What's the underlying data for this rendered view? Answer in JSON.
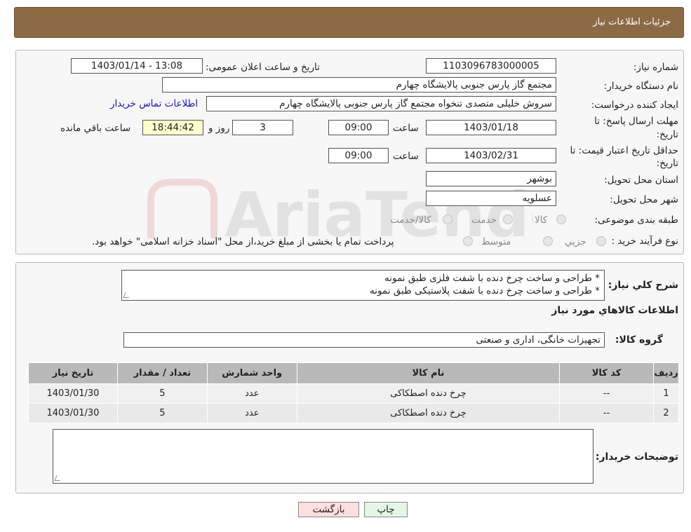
{
  "header": {
    "title": "جزئیات اطلاعات نیاز"
  },
  "fields": {
    "need_number_label": "شماره نیاز:",
    "need_number": "1103096783000005",
    "announce_label": "تاریخ و ساعت اعلان عمومی:",
    "announce_value": "1403/01/14 - 13:08",
    "buyer_org_label": "نام دستگاه خریدار:",
    "buyer_org": "مجتمع گاز پارس جنوبی  پالایشگاه چهارم",
    "requester_label": "ایجاد کننده درخواست:",
    "requester": "سروش خلیلی متصدی تنخواه مجتمع گاز پارس جنوبی  پالایشگاه چهارم",
    "contact_link": "اطلاعات تماس خریدار",
    "deadline_label_1": "مهلت ارسال پاسخ: تا",
    "deadline_label_2": "تاریخ:",
    "deadline_date": "1403/01/18",
    "time_label": "ساعت",
    "deadline_time": "09:00",
    "days_value": "3",
    "days_label": "روز و",
    "remaining_value": "18:44:42",
    "remaining_label": "ساعت باقي مانده",
    "validity_label_1": "حداقل تاریخ اعتبار قیمت: تا",
    "validity_label_2": "تاریخ:",
    "validity_date": "1403/02/31",
    "validity_time": "09:00",
    "province_label": "استان محل تحویل:",
    "province": "بوشهر",
    "city_label": "شهر محل تحویل:",
    "city": "عسلويه",
    "category_label": "طبقه بندی موضوعی:",
    "category_options": [
      "کالا",
      "خدمت",
      "کالا/خدمت"
    ],
    "process_label": "نوع فرآیند خرید :",
    "process_options": [
      "جزیي",
      "متوسط"
    ],
    "process_note": "پرداخت تمام یا بخشی از مبلغ خرید،از محل \"اسناد خزانه اسلامی\" خواهد بود."
  },
  "description": {
    "label": "شرح کلي نياز:",
    "lines": [
      "* طراحی و ساخت چرخ دنده با شفت فلزی طبق نمونه",
      "* طراحی و ساخت چرخ دنده با شفت پلاستیکی طبق نمونه"
    ]
  },
  "goods": {
    "section_title": "اطلاعات کالاهاي مورد نياز",
    "group_label": "گروه کالا:",
    "group_value": "تجهیزات خانگی، اداری و صنعتی",
    "columns": [
      "رديف",
      "کد کالا",
      "نام کالا",
      "واحد شمارش",
      "تعداد / مقدار",
      "تاريخ نياز"
    ],
    "rows": [
      [
        "1",
        "--",
        "چرخ دنده اصطکاکی",
        "عدد",
        "5",
        "1403/01/30"
      ],
      [
        "2",
        "--",
        "چرخ دنده اصطکاکی",
        "عدد",
        "5",
        "1403/01/30"
      ]
    ]
  },
  "buyer_notes": {
    "label": "توضیحات خریدار:",
    "value": ""
  },
  "buttons": {
    "print": "چاپ",
    "back": "بازگشت"
  },
  "watermark": {
    "text": "AriaTender.neT"
  }
}
